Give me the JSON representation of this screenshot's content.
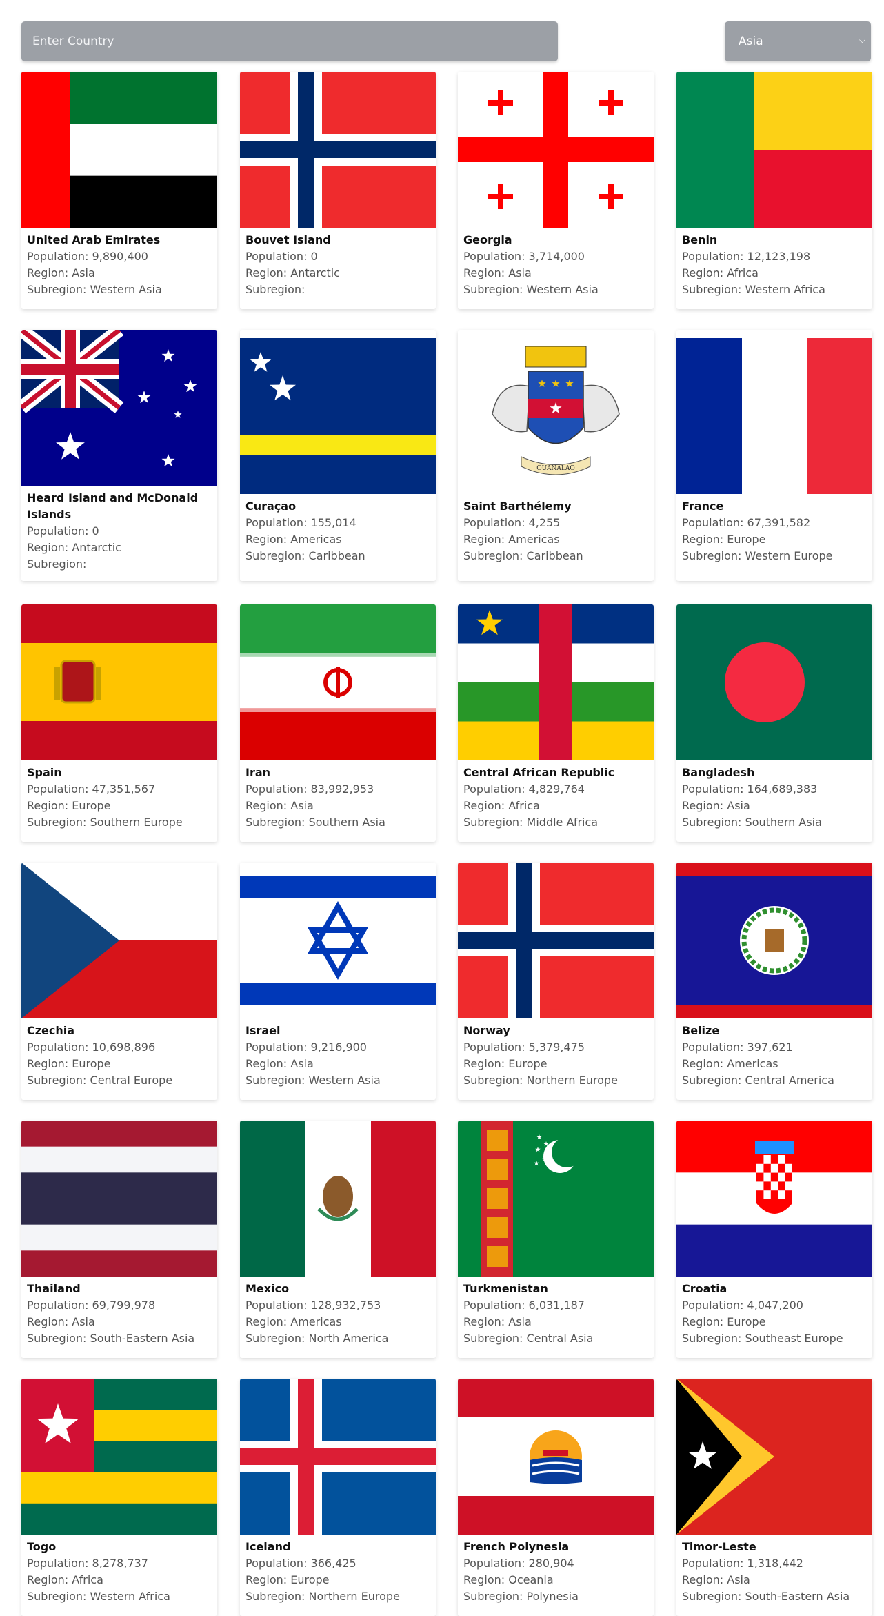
{
  "search": {
    "placeholder": "Enter Country",
    "value": ""
  },
  "region_select": {
    "selected": "Asia",
    "chevron_icon": "chevron-down-icon"
  },
  "labels": {
    "population": "Population: ",
    "region": "Region: ",
    "subregion": "Subregion: "
  },
  "countries": [
    {
      "name": "United Arab Emirates",
      "population": "9,890,400",
      "region": "Asia",
      "subregion": "Western Asia",
      "flag": "flag-uae"
    },
    {
      "name": "Bouvet Island",
      "population": "0",
      "region": "Antarctic",
      "subregion": "",
      "flag": "flag-bouvet-island"
    },
    {
      "name": "Georgia",
      "population": "3,714,000",
      "region": "Asia",
      "subregion": "Western Asia",
      "flag": "flag-georgia"
    },
    {
      "name": "Benin",
      "population": "12,123,198",
      "region": "Africa",
      "subregion": "Western Africa",
      "flag": "flag-benin"
    },
    {
      "name": "Heard Island and McDonald Islands",
      "population": "0",
      "region": "Antarctic",
      "subregion": "",
      "flag": "flag-heard-island"
    },
    {
      "name": "Curaçao",
      "population": "155,014",
      "region": "Americas",
      "subregion": "Caribbean",
      "flag": "flag-curacao"
    },
    {
      "name": "Saint Barthélemy",
      "population": "4,255",
      "region": "Americas",
      "subregion": "Caribbean",
      "flag": "flag-saint-barthelemy"
    },
    {
      "name": "France",
      "population": "67,391,582",
      "region": "Europe",
      "subregion": "Western Europe",
      "flag": "flag-france"
    },
    {
      "name": "Spain",
      "population": "47,351,567",
      "region": "Europe",
      "subregion": "Southern Europe",
      "flag": "flag-spain"
    },
    {
      "name": "Iran",
      "population": "83,992,953",
      "region": "Asia",
      "subregion": "Southern Asia",
      "flag": "flag-iran"
    },
    {
      "name": "Central African Republic",
      "population": "4,829,764",
      "region": "Africa",
      "subregion": "Middle Africa",
      "flag": "flag-central-african-republic"
    },
    {
      "name": "Bangladesh",
      "population": "164,689,383",
      "region": "Asia",
      "subregion": "Southern Asia",
      "flag": "flag-bangladesh"
    },
    {
      "name": "Czechia",
      "population": "10,698,896",
      "region": "Europe",
      "subregion": "Central Europe",
      "flag": "flag-czechia"
    },
    {
      "name": "Israel",
      "population": "9,216,900",
      "region": "Asia",
      "subregion": "Western Asia",
      "flag": "flag-israel"
    },
    {
      "name": "Norway",
      "population": "5,379,475",
      "region": "Europe",
      "subregion": "Northern Europe",
      "flag": "flag-norway"
    },
    {
      "name": "Belize",
      "population": "397,621",
      "region": "Americas",
      "subregion": "Central America",
      "flag": "flag-belize"
    },
    {
      "name": "Thailand",
      "population": "69,799,978",
      "region": "Asia",
      "subregion": "South-Eastern Asia",
      "flag": "flag-thailand"
    },
    {
      "name": "Mexico",
      "population": "128,932,753",
      "region": "Americas",
      "subregion": "North America",
      "flag": "flag-mexico"
    },
    {
      "name": "Turkmenistan",
      "population": "6,031,187",
      "region": "Asia",
      "subregion": "Central Asia",
      "flag": "flag-turkmenistan"
    },
    {
      "name": "Croatia",
      "population": "4,047,200",
      "region": "Europe",
      "subregion": "Southeast Europe",
      "flag": "flag-croatia"
    },
    {
      "name": "Togo",
      "population": "8,278,737",
      "region": "Africa",
      "subregion": "Western Africa",
      "flag": "flag-togo"
    },
    {
      "name": "Iceland",
      "population": "366,425",
      "region": "Europe",
      "subregion": "Northern Europe",
      "flag": "flag-iceland"
    },
    {
      "name": "French Polynesia",
      "population": "280,904",
      "region": "Oceania",
      "subregion": "Polynesia",
      "flag": "flag-french-polynesia"
    },
    {
      "name": "Timor-Leste",
      "population": "1,318,442",
      "region": "Asia",
      "subregion": "South-Eastern Asia",
      "flag": "flag-timor-leste"
    }
  ]
}
